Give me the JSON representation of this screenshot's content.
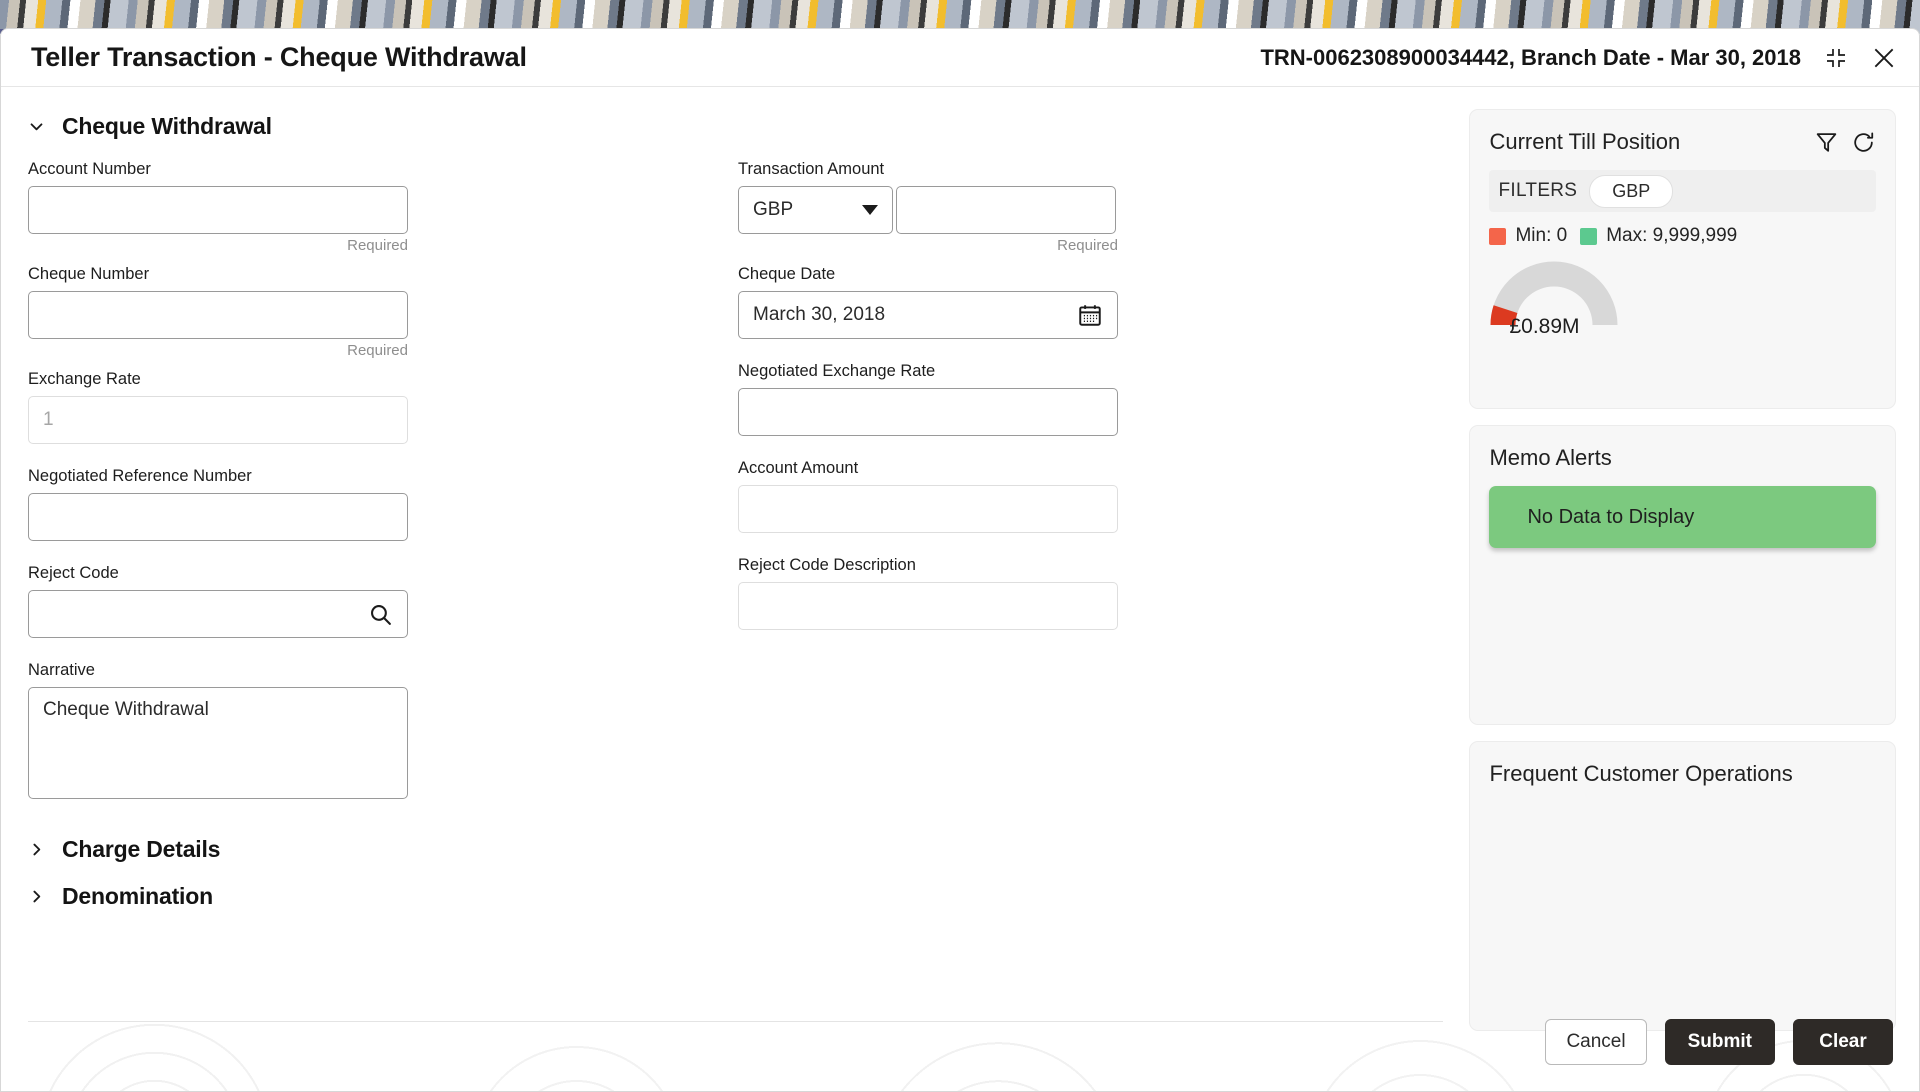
{
  "window": {
    "title": "Teller Transaction - Cheque Withdrawal",
    "reference": "TRN-0062308900034442, Branch Date - Mar 30, 2018",
    "restore_icon": "restore-down-icon",
    "close_icon": "close-icon"
  },
  "section": {
    "title": "Cheque Withdrawal",
    "expanded_icon": "chevron-down-icon"
  },
  "form": {
    "account_number": {
      "label": "Account Number",
      "value": "",
      "helper": "Required"
    },
    "cheque_number": {
      "label": "Cheque Number",
      "value": "",
      "helper": "Required"
    },
    "exchange_rate": {
      "label": "Exchange Rate",
      "value": "",
      "placeholder": "1"
    },
    "negotiated_reference_number": {
      "label": "Negotiated Reference Number",
      "value": ""
    },
    "reject_code": {
      "label": "Reject Code",
      "value": "",
      "icon": "search-icon"
    },
    "narrative": {
      "label": "Narrative",
      "value": "Cheque Withdrawal"
    },
    "transaction_amount": {
      "label": "Transaction Amount",
      "currency": "GBP",
      "currency_icon": "chevron-down-icon",
      "amount": "",
      "helper": "Required"
    },
    "cheque_date": {
      "label": "Cheque Date",
      "value": "March 30, 2018",
      "icon": "calendar-icon"
    },
    "negotiated_exchange_rate": {
      "label": "Negotiated Exchange Rate",
      "value": ""
    },
    "account_amount": {
      "label": "Account Amount",
      "value": ""
    },
    "reject_code_description": {
      "label": "Reject Code Description",
      "value": ""
    }
  },
  "subsections": [
    {
      "title": "Charge Details",
      "icon": "chevron-right-icon"
    },
    {
      "title": "Denomination",
      "icon": "chevron-right-icon"
    }
  ],
  "actions": {
    "cancel": "Cancel",
    "submit": "Submit",
    "clear": "Clear"
  },
  "sidebar": {
    "till": {
      "title": "Current Till Position",
      "filter_icon": "filter-icon",
      "refresh_icon": "refresh-icon",
      "filters_label": "FILTERS",
      "currency_chip": "GBP",
      "min_label": "Min: 0",
      "max_label": "Max: 9,999,999",
      "min_color": "#f4654a",
      "max_color": "#5cc98f",
      "gauge_value_label": "£0.89M",
      "gauge_arc_color": "#d8d8d8",
      "gauge_fill_color": "#dc3a20"
    },
    "memo": {
      "title": "Memo Alerts",
      "banner_text": "No Data to Display",
      "banner_color": "#7cc97f"
    },
    "frequent": {
      "title": "Frequent Customer Operations"
    }
  },
  "chart_data": {
    "type": "gauge",
    "title": "Current Till Position",
    "value": 0.89,
    "value_label": "£0.89M",
    "unit": "GBP millions",
    "min": 0,
    "max": 9999999,
    "min_label": "Min: 0",
    "max_label": "Max: 9,999,999",
    "percent_filled": 8.9,
    "arc_start_deg": 180,
    "arc_end_deg": 360,
    "track_color": "#d8d8d8",
    "fill_color": "#dc3a20",
    "legend": [
      {
        "name": "Min: 0",
        "color": "#f4654a"
      },
      {
        "name": "Max: 9,999,999",
        "color": "#5cc98f"
      }
    ],
    "legend_position": "top",
    "grid": false
  }
}
